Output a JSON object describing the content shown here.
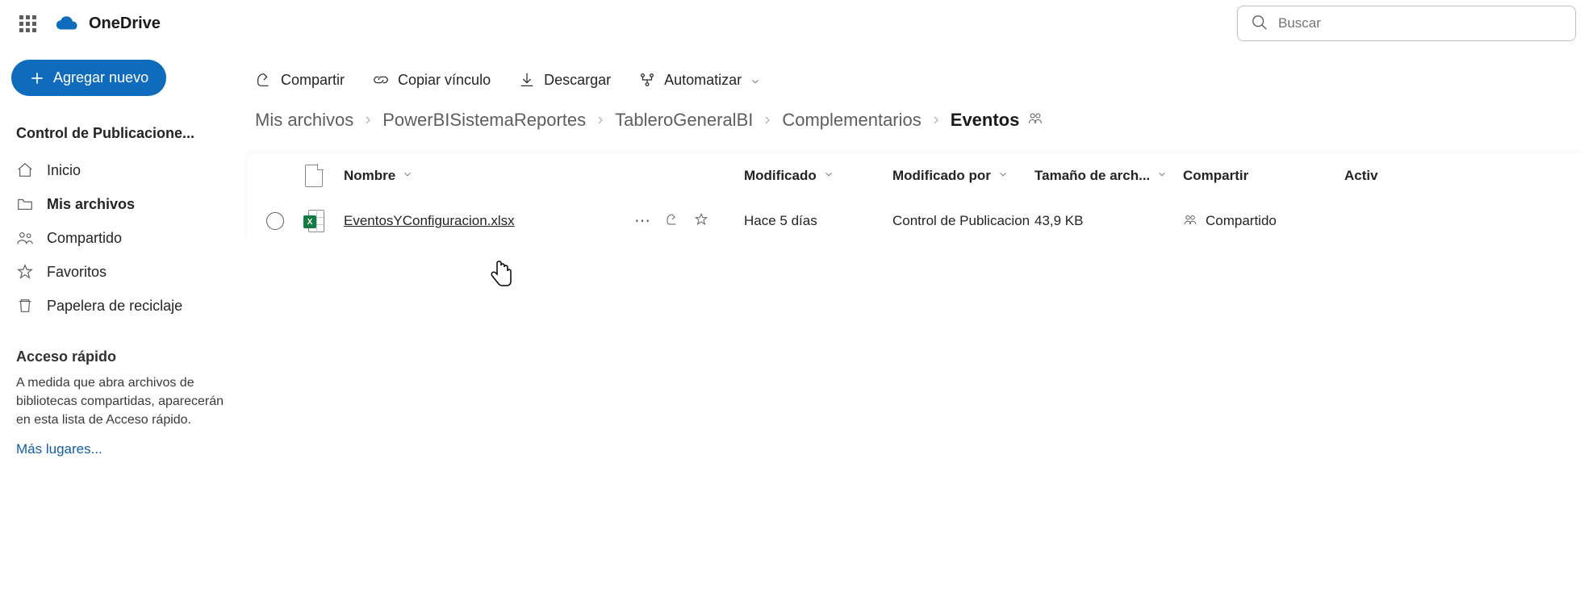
{
  "brand": {
    "name": "OneDrive"
  },
  "search": {
    "placeholder": "Buscar"
  },
  "sidebar": {
    "add_label": "Agregar nuevo",
    "library_title": "Control de Publicacione...",
    "nav": [
      {
        "label": "Inicio"
      },
      {
        "label": "Mis archivos"
      },
      {
        "label": "Compartido"
      },
      {
        "label": "Favoritos"
      },
      {
        "label": "Papelera de reciclaje"
      }
    ],
    "quick": {
      "title": "Acceso rápido",
      "desc": "A medida que abra archivos de bibliotecas compartidas, aparecerán en esta lista de Acceso rápido.",
      "link": "Más lugares..."
    }
  },
  "toolbar": {
    "share": "Compartir",
    "copylink": "Copiar vínculo",
    "download": "Descargar",
    "automate": "Automatizar"
  },
  "breadcrumb": [
    "Mis archivos",
    "PowerBISistemaReportes",
    "TableroGeneralBI",
    "Complementarios",
    "Eventos"
  ],
  "columns": {
    "name": "Nombre",
    "modified": "Modificado",
    "modifiedby": "Modificado por",
    "size": "Tamaño de arch...",
    "share": "Compartir",
    "activity": "Activ"
  },
  "rows": [
    {
      "filename": "EventosYConfiguracion.xlsx",
      "modified": "Hace 5 días",
      "modifiedby": "Control de Publicacion",
      "size": "43,9 KB",
      "share": "Compartido",
      "xls_badge": "X"
    }
  ]
}
